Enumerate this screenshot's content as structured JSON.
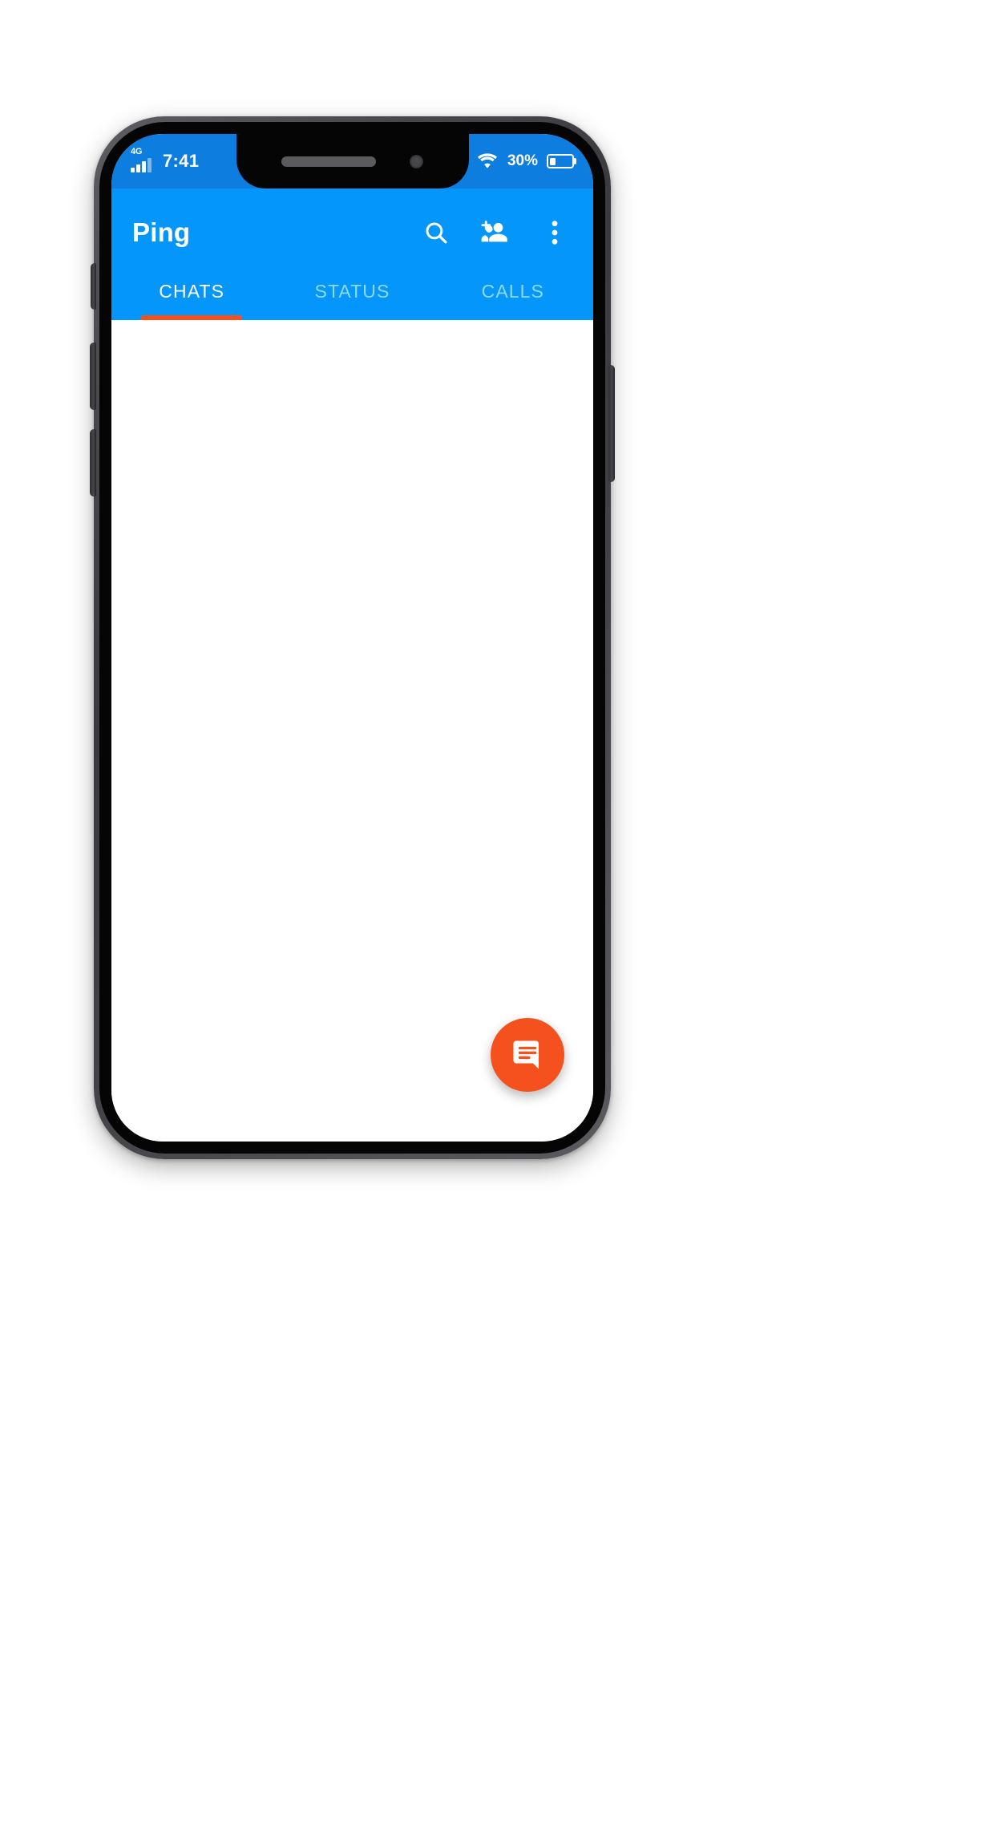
{
  "device": {
    "frame_color": "#4a4a4e",
    "body_color": "#050505",
    "notch": {
      "speaker_name": "earpiece-speaker",
      "camera_name": "front-camera"
    },
    "buttons": [
      {
        "name": "silent-switch"
      },
      {
        "name": "volume-up-button"
      },
      {
        "name": "volume-down-button"
      },
      {
        "name": "power-button"
      }
    ]
  },
  "status_bar": {
    "background": "#0d7ee0",
    "network_type": "4G",
    "time": "7:41",
    "battery_percent": "30%",
    "battery_level": 30,
    "icons": {
      "signal": "signal-cellular-icon",
      "wifi": "wifi-icon",
      "battery": "battery-icon"
    }
  },
  "app_bar": {
    "background": "#0496FA",
    "title": "Ping",
    "actions": [
      {
        "name": "search-icon",
        "label": "Search"
      },
      {
        "name": "add-person-icon",
        "label": "New contact"
      },
      {
        "name": "overflow-menu-icon",
        "label": "More options"
      }
    ]
  },
  "tabs": {
    "active_index": 0,
    "indicator_color": "#F4511E",
    "active_color": "#FFFFFF",
    "inactive_color": "#8ddafd",
    "items": [
      {
        "label": "CHATS"
      },
      {
        "label": "STATUS"
      },
      {
        "label": "CALLS"
      }
    ]
  },
  "content": {
    "background": "#FFFFFF",
    "chat_list": [],
    "empty": true
  },
  "fab": {
    "name": "new-chat-fab",
    "color": "#F4511E",
    "icon": "chat-message-icon",
    "label": "New chat"
  }
}
